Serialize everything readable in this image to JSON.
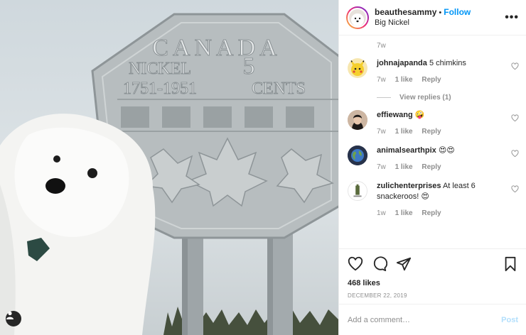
{
  "post": {
    "username": "beauthesammy",
    "separator": "•",
    "follow_label": "Follow",
    "location": "Big Nickel",
    "more_label": "•••"
  },
  "photo": {
    "coin_text": {
      "country": "CANADA",
      "word": "NICKEL",
      "years": "1751-1951",
      "value": "5",
      "cents": "CENTS"
    }
  },
  "caption_time": "7w",
  "comments": [
    {
      "username": "johnajapanda",
      "text": "5 chimkins",
      "time": "7w",
      "likes": "1 like",
      "reply": "Reply",
      "avatar": "pikachu-avatar"
    },
    {
      "username": "effiewang",
      "text": "🤪",
      "time": "7w",
      "likes": "1 like",
      "reply": "Reply",
      "avatar": "portrait-avatar"
    },
    {
      "username": "animalsearthpix",
      "text": "😍😍",
      "time": "7w",
      "likes": "1 like",
      "reply": "Reply",
      "avatar": "earth-avatar"
    },
    {
      "username": "zulichenterprises",
      "text": "At least 6 snackeroos! 😍",
      "time": "1w",
      "likes": "1 like",
      "reply": "Reply",
      "avatar": "logo-avatar"
    }
  ],
  "view_replies": "View replies (1)",
  "likes": "468 likes",
  "date": "DECEMBER 22, 2019",
  "add_comment": {
    "placeholder": "Add a comment…",
    "post_label": "Post"
  },
  "colors": {
    "follow": "#0095f6",
    "post_disabled": "#b2dffc",
    "muted": "#8e8e8e",
    "text": "#262626"
  }
}
